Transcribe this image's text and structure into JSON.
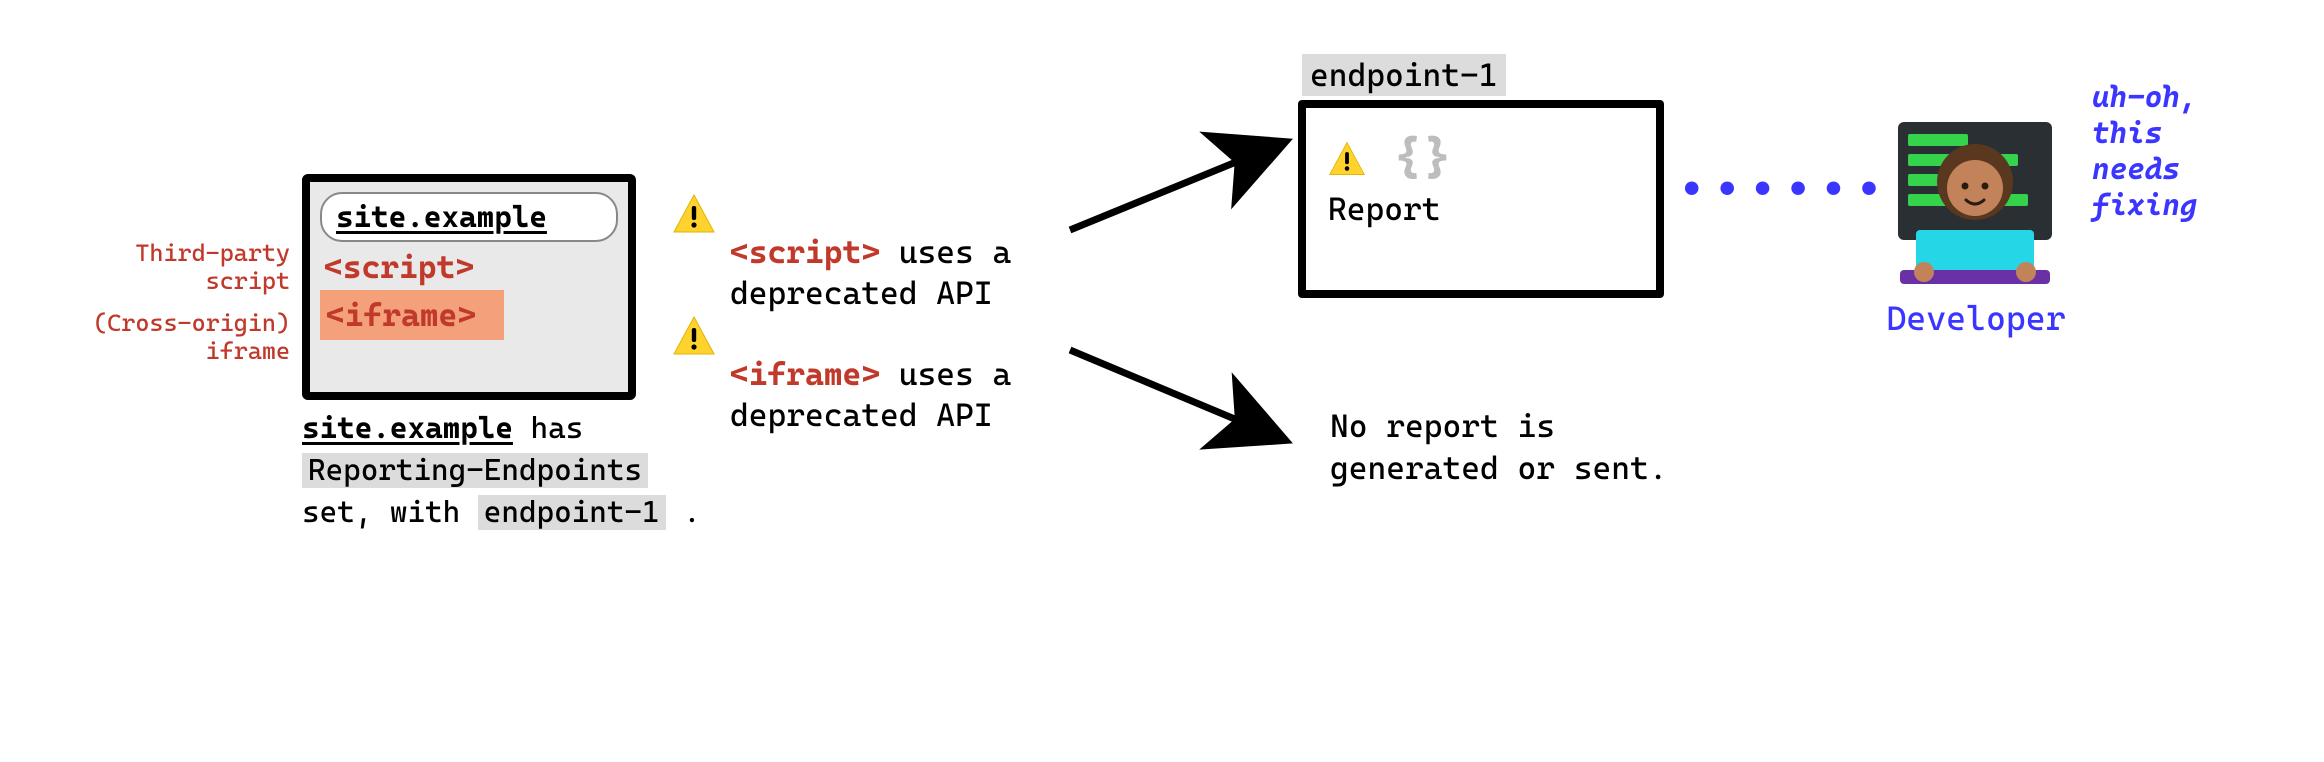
{
  "site": {
    "url": "site.example",
    "script_tag": "<script>",
    "iframe_tag": "<iframe>"
  },
  "left_annotation": {
    "script": "Third-party\nscript",
    "iframe": "(Cross-origin)\niframe"
  },
  "caption": {
    "line1_url": "site.example",
    "line1_rest": " has",
    "line2_header": "Reporting-Endpoints",
    "line3_pre": "set, with ",
    "line3_endpoint": "endpoint-1",
    "line3_post": " ."
  },
  "warnings": {
    "script_pre": "<script>",
    "script_post": " uses a\ndeprecated API",
    "iframe_pre": "<iframe>",
    "iframe_post": " uses a\ndeprecated API"
  },
  "endpoint": {
    "name": "endpoint-1",
    "report_label": "Report"
  },
  "no_report": "No report is\ngenerated or sent.",
  "dots": "••••••",
  "developer": {
    "label": "Developer",
    "thought": "uh-oh,\nthis\nneeds\nfixing"
  }
}
